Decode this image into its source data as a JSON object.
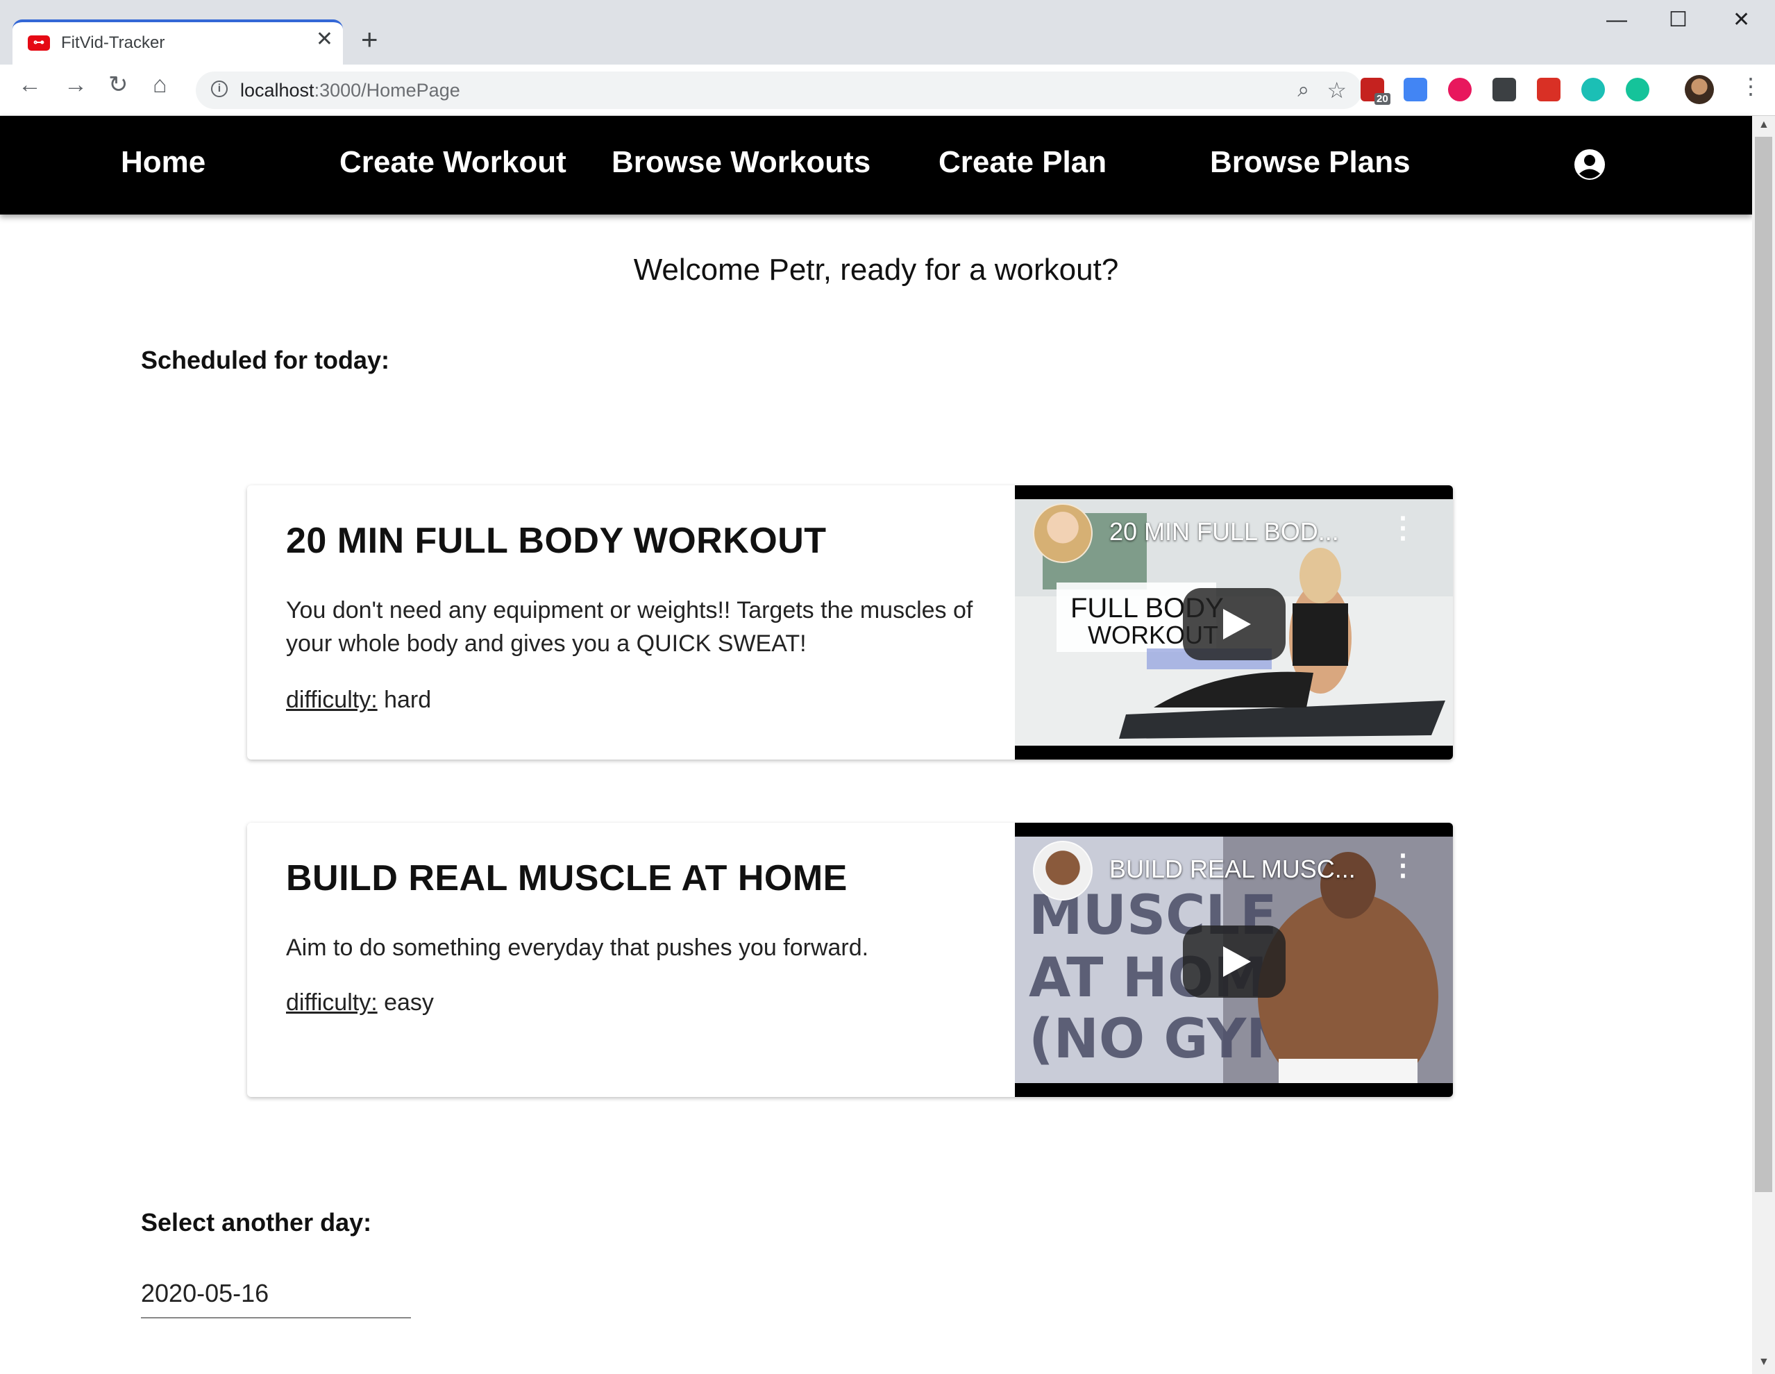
{
  "browser": {
    "tab_title": "FitVid-Tracker",
    "tab_close": "✕",
    "new_tab": "+",
    "url_host": "localhost",
    "url_path": ":3000/HomePage",
    "window_controls": {
      "minimize": "—",
      "maximize": "☐",
      "close": "✕"
    },
    "extensions": [
      {
        "name": "adblock-icon",
        "color": "#c5221f",
        "badge": "20"
      },
      {
        "name": "translate-icon",
        "color": "#4285f4"
      },
      {
        "name": "media-icon",
        "color": "#e8175d"
      },
      {
        "name": "json-icon",
        "color": "#3c4043"
      },
      {
        "name": "grid-extension-icon",
        "color": "#d93025"
      },
      {
        "name": "teal-extension-icon",
        "color": "#1bbfb5"
      },
      {
        "name": "grammar-extension-icon",
        "color": "#15c39a"
      }
    ]
  },
  "nav": {
    "items": [
      "Home",
      "Create Workout",
      "Browse Workouts",
      "Create Plan",
      "Browse Plans"
    ],
    "background": "#000000"
  },
  "welcome": "Welcome Petr, ready for a workout?",
  "scheduled_label": "Scheduled for today:",
  "workouts": [
    {
      "title": "20 MIN FULL BODY WORKOUT",
      "description": "You don't need any equipment or weights!! Targets the muscles of your whole body and gives you a QUICK SWEAT!",
      "difficulty_label": "difficulty:",
      "difficulty": "hard",
      "video_title": "20 MIN FULL BOD..."
    },
    {
      "title": "BUILD REAL MUSCLE AT HOME",
      "description": "Aim to do something everyday that pushes you forward.",
      "difficulty_label": "difficulty:",
      "difficulty": "easy",
      "video_title": "BUILD REAL MUSC..."
    }
  ],
  "select_label": "Select another day:",
  "date_value": "2020-05-16"
}
